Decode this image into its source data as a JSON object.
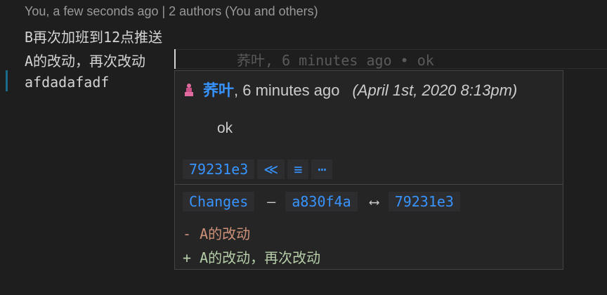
{
  "codelens": "You, a few seconds ago | 2 authors (You and others)",
  "editor": {
    "lines": [
      "B再次加班到12点推送",
      "A的改动，再次改动",
      "afdadafadf"
    ]
  },
  "inline_blame": "荞叶, 6 minutes ago • ok",
  "hover": {
    "author": "荞叶",
    "relative_time": ", 6 minutes ago",
    "full_date": "(April 1st, 2020 8:13pm)",
    "message": "ok",
    "sha": "79231e3",
    "actions": {
      "previous": "≪",
      "details": "≡",
      "more": "⋯"
    },
    "changes_label": "Changes",
    "dash": "—",
    "from_sha": "a830f4a",
    "arrow": "⟷",
    "to_sha": "79231e3",
    "diff_removed": "- A的改动",
    "diff_added": "+ A的改动，再次改动"
  },
  "colors": {
    "link": "#3794ff",
    "avatar": "#e06c9f",
    "deleted": "#ce9178",
    "added": "#b5cea8"
  },
  "icons": {
    "avatar": "avatar-icon"
  }
}
